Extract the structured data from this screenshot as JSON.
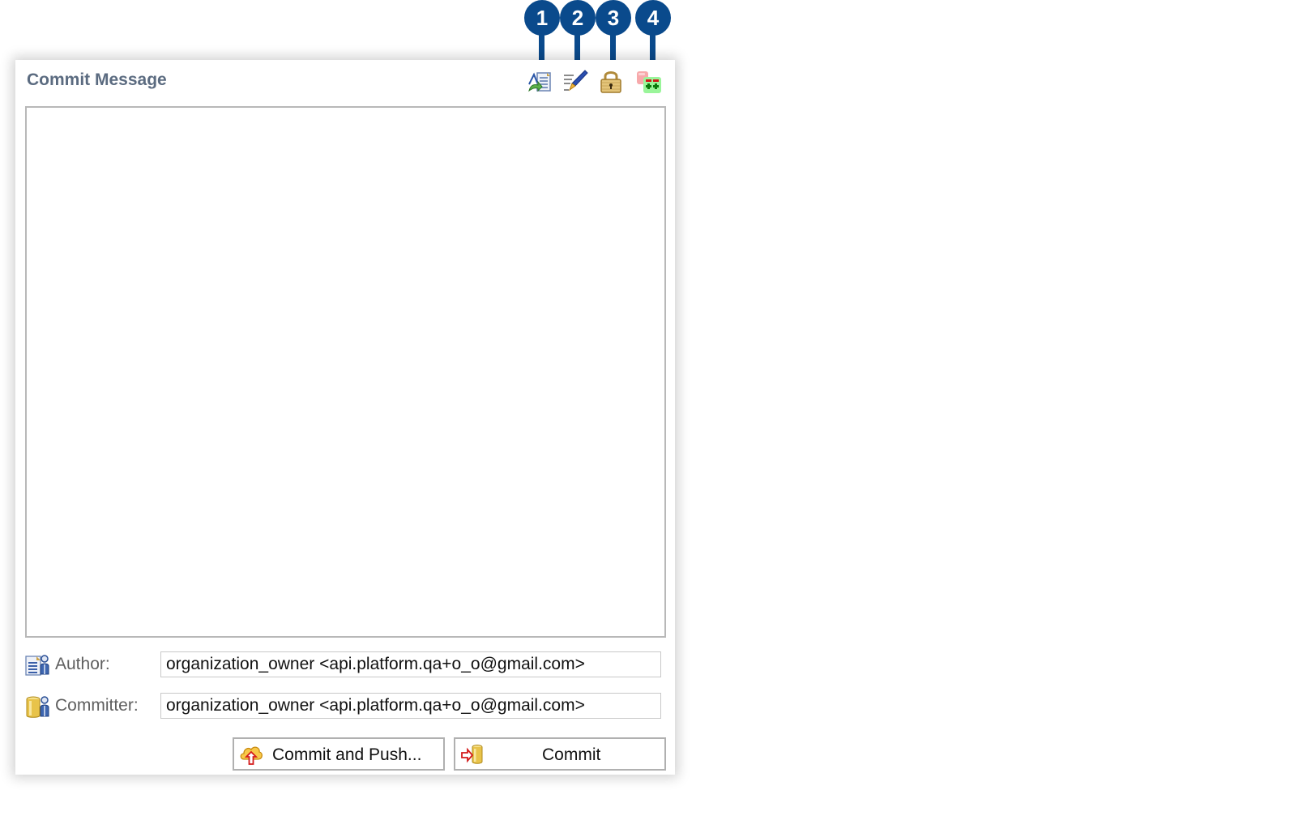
{
  "panel": {
    "title": "Commit Message",
    "toolbar": [
      {
        "name": "add-signed-off-by",
        "icon": "document-arrow-icon"
      },
      {
        "name": "compute-change-id",
        "icon": "pen-edit-icon"
      },
      {
        "name": "sign-commit",
        "icon": "lock-icon"
      },
      {
        "name": "amend-commit",
        "icon": "add-changes-icon"
      }
    ],
    "message": {
      "value": "",
      "placeholder": ""
    },
    "author": {
      "label": "Author:",
      "value": "organization_owner <api.platform.qa+o_o@gmail.com>"
    },
    "committer": {
      "label": "Committer:",
      "value": "organization_owner <api.platform.qa+o_o@gmail.com>"
    },
    "buttons": {
      "commit_and_push": "Commit and Push...",
      "commit": "Commit"
    }
  },
  "callouts": [
    "1",
    "2",
    "3",
    "4"
  ],
  "colors": {
    "callout": "#0a4a8c",
    "title": "#5b6b80"
  }
}
